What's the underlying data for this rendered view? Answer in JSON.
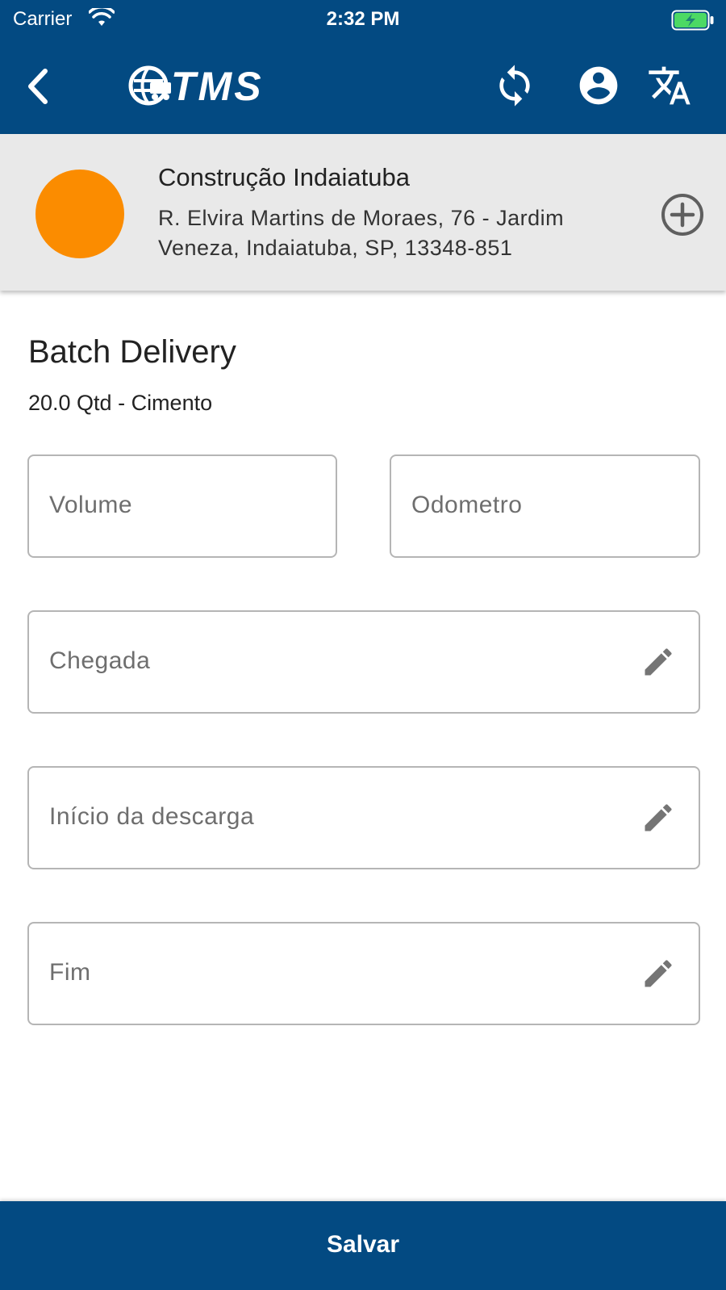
{
  "status_bar": {
    "carrier": "Carrier",
    "time": "2:32 PM",
    "battery_color": "#4cd964"
  },
  "app_bar": {
    "logo_text": "TMS",
    "background": "#034a82",
    "icons": [
      "back-arrow-icon",
      "sync-icon",
      "account-circle-icon",
      "translate-icon"
    ]
  },
  "client": {
    "name": "Construção Indaiatuba",
    "address": "R. Elvira Martins de Moraes, 76 - Jardim Veneza, Indaiatuba, SP, 13348-851",
    "avatar_color": "#fb8c00"
  },
  "delivery": {
    "title": "Batch Delivery",
    "subtitle": "20.0 Qtd - Cimento"
  },
  "form": {
    "volume_label": "Volume",
    "odometro_label": "Odometro",
    "chegada_label": "Chegada",
    "inicio_label": "Início da descarga",
    "fim_label": "Fim"
  },
  "footer": {
    "save_label": "Salvar"
  }
}
